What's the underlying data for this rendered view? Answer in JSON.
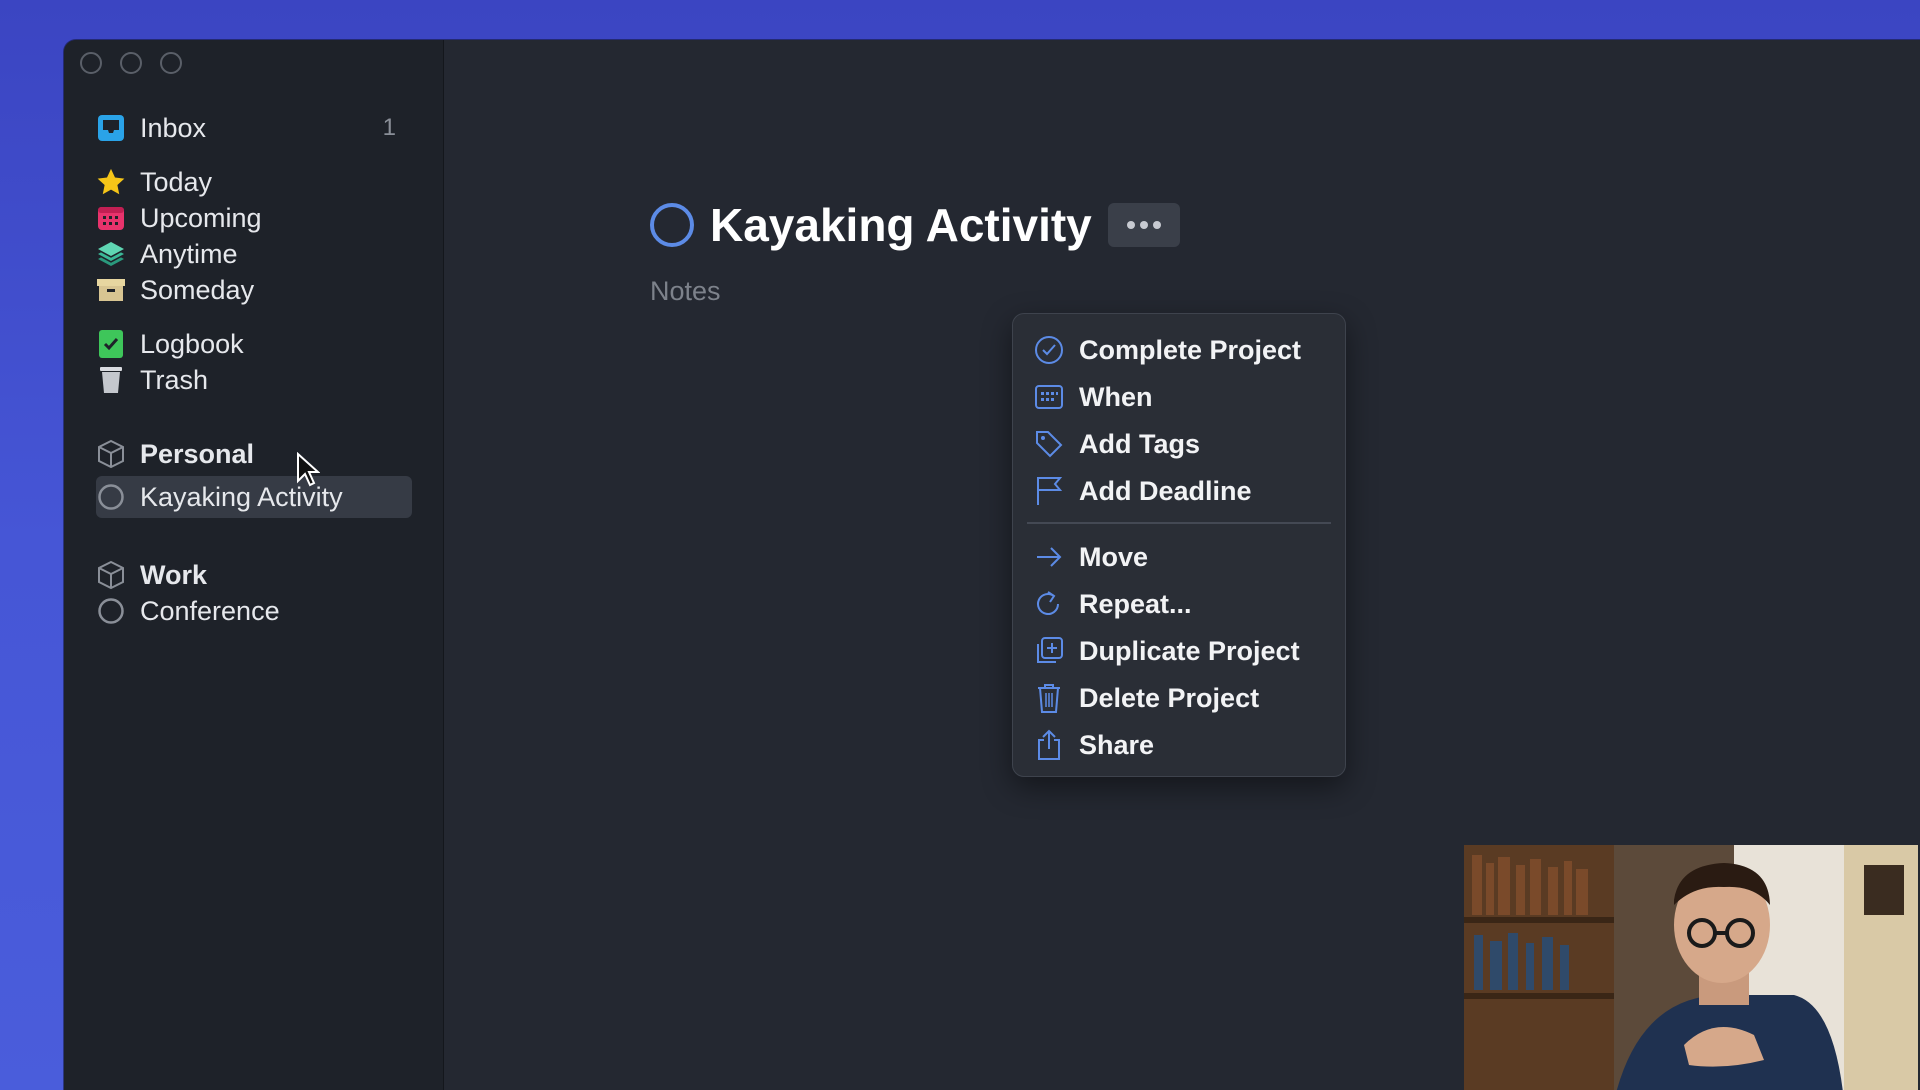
{
  "sidebar": {
    "items": [
      {
        "label": "Inbox",
        "count": "1",
        "icon": "inbox-icon"
      },
      {
        "label": "Today",
        "icon": "star-icon"
      },
      {
        "label": "Upcoming",
        "icon": "calendar-icon"
      },
      {
        "label": "Anytime",
        "icon": "layers-icon"
      },
      {
        "label": "Someday",
        "icon": "archive-box-icon"
      },
      {
        "label": "Logbook",
        "icon": "logbook-icon"
      },
      {
        "label": "Trash",
        "icon": "trash-icon"
      },
      {
        "label": "Personal",
        "icon": "area-cube-icon"
      },
      {
        "label": "Kayaking Activity",
        "icon": "project-circle-icon"
      },
      {
        "label": "Work",
        "icon": "area-cube-icon"
      },
      {
        "label": "Conference",
        "icon": "project-circle-icon"
      }
    ]
  },
  "main": {
    "title": "Kayaking Activity",
    "notes_placeholder": "Notes"
  },
  "context_menu": {
    "items": [
      {
        "label": "Complete Project",
        "icon": "check-circle-icon"
      },
      {
        "label": "When",
        "icon": "calendar-icon"
      },
      {
        "label": "Add Tags",
        "icon": "tag-icon"
      },
      {
        "label": "Add Deadline",
        "icon": "flag-icon"
      },
      {
        "label": "Move",
        "icon": "arrow-right-icon"
      },
      {
        "label": "Repeat...",
        "icon": "repeat-icon"
      },
      {
        "label": "Duplicate Project",
        "icon": "duplicate-icon"
      },
      {
        "label": "Delete Project",
        "icon": "trash-icon"
      },
      {
        "label": "Share",
        "icon": "share-icon"
      }
    ]
  },
  "colors": {
    "accent": "#5c8be6",
    "inbox": "#2aa3e8",
    "today": "#f5c518",
    "upcoming": "#e8336c",
    "anytime": "#3bb897",
    "someday": "#d8c592",
    "logbook": "#3ec65a"
  }
}
